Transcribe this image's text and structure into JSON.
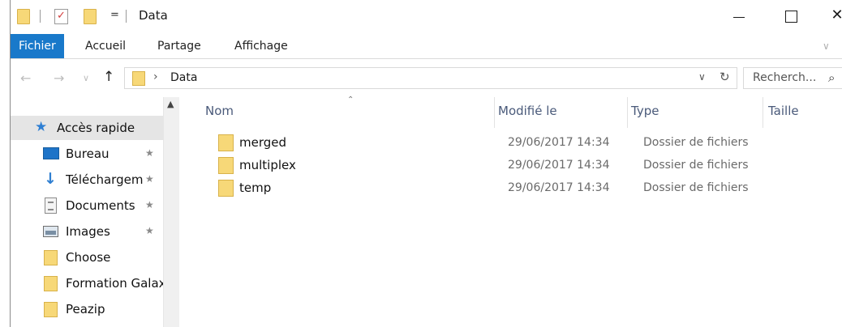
{
  "window": {
    "title": "Data",
    "qat_arrow": "=",
    "close_symbol": "✕"
  },
  "ribbon": {
    "tabs": [
      {
        "label": "Fichier",
        "active": true
      },
      {
        "label": "Accueil",
        "active": false
      },
      {
        "label": "Partage",
        "active": false
      },
      {
        "label": "Affichage",
        "active": false
      }
    ],
    "expand_symbol": "∨"
  },
  "nav": {
    "back_symbol": "←",
    "forward_symbol": "→",
    "recent_symbol": "∨",
    "up_symbol": "↑",
    "breadcrumb_sep": "›",
    "path": "Data",
    "dropdown_symbol": "∨",
    "refresh_symbol": "↻"
  },
  "search": {
    "placeholder": "Recherch...",
    "icon_symbol": "⌕"
  },
  "sidebar": {
    "pin_symbol": "★",
    "items": [
      {
        "label": "Accès rapide",
        "icon": "star-icon",
        "selected": true
      },
      {
        "label": "Bureau",
        "icon": "desktop-icon",
        "pinned": true
      },
      {
        "label": "Téléchargem…",
        "icon": "download-icon",
        "pinned": true
      },
      {
        "label": "Documents",
        "icon": "documents-icon",
        "pinned": true
      },
      {
        "label": "Images",
        "icon": "images-icon",
        "pinned": true
      },
      {
        "label": "Choose",
        "icon": "folder-icon"
      },
      {
        "label": "Formation Galax",
        "icon": "folder-icon"
      },
      {
        "label": "Peazip",
        "icon": "folder-icon"
      }
    ]
  },
  "columns": {
    "name": "Nom",
    "modified": "Modifié le",
    "type": "Type",
    "size": "Taille"
  },
  "files": [
    {
      "name": "merged",
      "modified": "29/06/2017 14:34",
      "type": "Dossier de fichiers"
    },
    {
      "name": "multiplex",
      "modified": "29/06/2017 14:34",
      "type": "Dossier de fichiers"
    },
    {
      "name": "temp",
      "modified": "29/06/2017 14:34",
      "type": "Dossier de fichiers"
    }
  ],
  "colors": {
    "accent": "#1979ca",
    "folder": "#f7d878",
    "selection": "#e5e5e5"
  }
}
